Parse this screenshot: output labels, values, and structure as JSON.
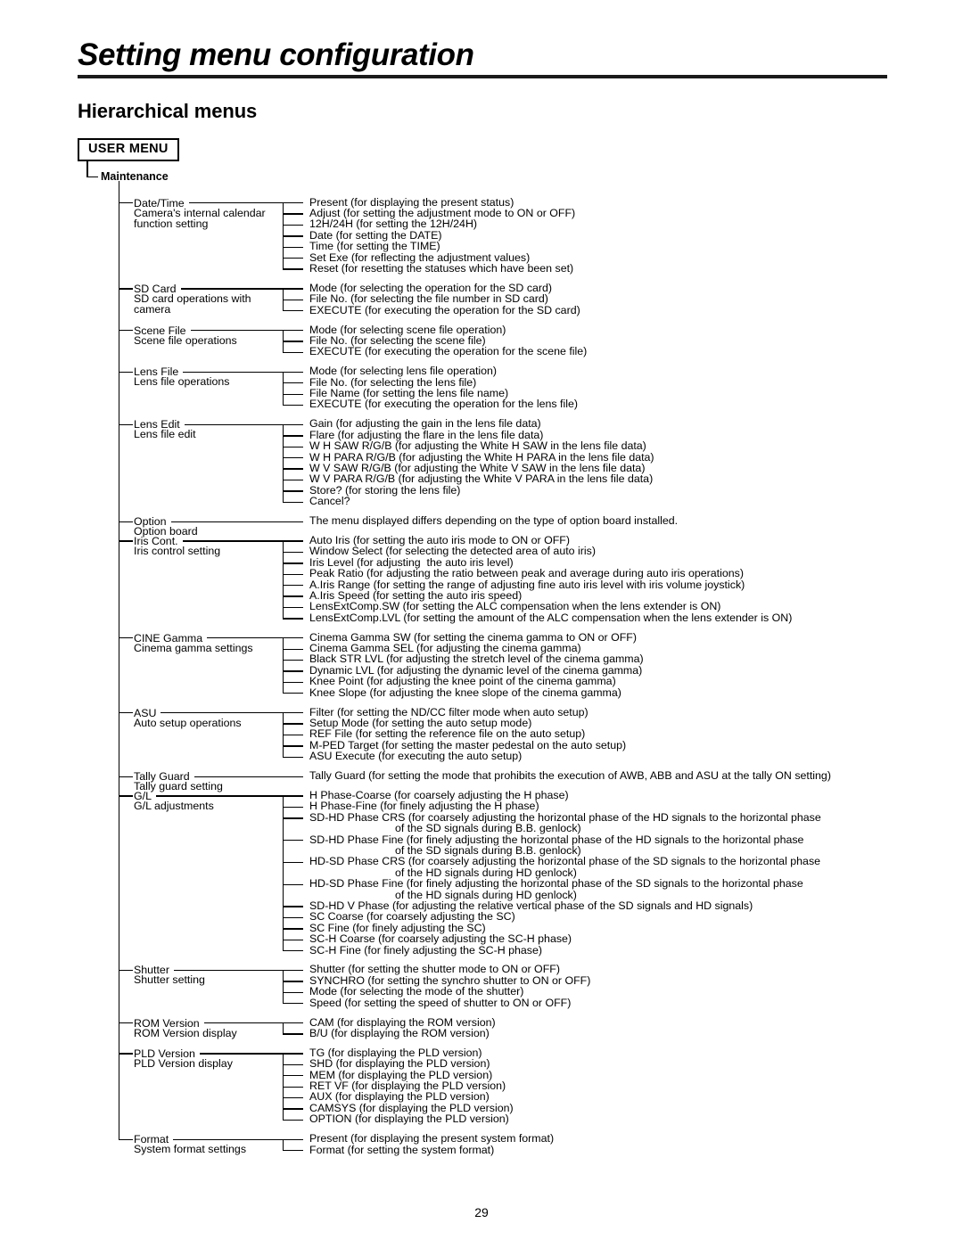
{
  "header": {
    "chapter_title": "Setting menu configuration",
    "section_title": "Hierarchical menus",
    "menu_box_label": "USER MENU",
    "root_node": "Maintenance"
  },
  "page_number": "29",
  "tree": {
    "groups": [
      {
        "name": "Date/Time",
        "desc": "Camera's internal calendar\nfunction setting",
        "rule_end": 318,
        "children": [
          "Present (for displaying the present status)",
          "Adjust (for setting the adjustment mode to ON or OFF)",
          "12H/24H (for setting the 12H/24H)",
          "Date (for setting the DATE)",
          "Time (for setting the TIME)",
          "Set Exe (for reflecting the adjustment values)",
          "Reset (for resetting the statuses which have been set)"
        ]
      },
      {
        "name": "SD Card",
        "desc": "SD card operations with\ncamera",
        "rule_end": 318,
        "children": [
          "Mode (for selecting the operation for the SD card)",
          "File No. (for selecting the file number in SD card)",
          "EXECUTE (for executing the operation for the SD card)"
        ]
      },
      {
        "name": "Scene File",
        "desc": "Scene file operations",
        "rule_end": 318,
        "children": [
          "Mode (for selecting scene file operation)",
          "File No. (for selecting the scene file)",
          "EXECUTE (for executing the operation for the scene file)"
        ]
      },
      {
        "name": "Lens File",
        "desc": "Lens file operations",
        "rule_end": 318,
        "children": [
          "Mode (for selecting lens file operation)",
          "File No. (for selecting the lens file)",
          "File Name (for setting the lens file name)",
          "EXECUTE (for executing the operation for the lens file)"
        ]
      },
      {
        "name": "Lens Edit",
        "desc": "Lens file edit",
        "rule_end": 318,
        "children": [
          "Gain (for adjusting the gain in the lens file data)",
          "Flare (for adjusting the flare in the lens file data)",
          "W H SAW R/G/B (for adjusting the White H SAW in the lens file data)",
          "W H PARA R/G/B (for adjusting the White H PARA in the lens file data)",
          "W V SAW R/G/B (for adjusting the White V SAW in the lens file data)",
          "W V PARA R/G/B (for adjusting the White V PARA in the lens file data)",
          "Store? (for storing the lens file)",
          "Cancel?"
        ]
      },
      {
        "name": "Option",
        "desc": "Option board",
        "rule_end": 340,
        "children": [
          "The menu displayed differs depending on the type of option board installed."
        ]
      },
      {
        "name": "Iris Cont.",
        "desc": "Iris control setting",
        "rule_end": 318,
        "children": [
          "Auto Iris (for setting the auto iris mode to ON or OFF)",
          "Window Select (for selecting the detected area of auto iris)",
          "Iris Level (for adjusting  the auto iris level)",
          "Peak Ratio (for adjusting the ratio between peak and average during auto iris operations)",
          "A.Iris Range (for setting the range of adjusting fine auto iris level with iris volume joystick)",
          "A.Iris Speed (for setting the auto iris speed)",
          "LensExtComp.SW (for setting the ALC compensation when the lens extender is ON)",
          "LensExtComp.LVL (for setting the amount of the ALC compensation when the lens extender is ON)"
        ]
      },
      {
        "name": "CINE Gamma",
        "desc": "Cinema gamma settings",
        "rule_end": 318,
        "children": [
          "Cinema Gamma SW (for setting the cinema gamma to ON or OFF)",
          "Cinema Gamma SEL (for adjusting the cinema gamma)",
          "Black STR LVL (for adjusting the stretch level of the cinema gamma)",
          "Dynamic LVL (for adjusting the dynamic level of the cinema gamma)",
          "Knee Point (for adjusting the knee point of the cinema gamma)",
          "Knee Slope (for adjusting the knee slope of the cinema gamma)"
        ]
      },
      {
        "name": "ASU",
        "desc": "Auto setup operations",
        "rule_end": 318,
        "children": [
          "Filter (for setting the ND/CC filter mode when auto setup)",
          "Setup Mode (for setting the auto setup mode)",
          "REF File (for setting the reference file on the auto setup)",
          "M-PED Target (for setting the master pedestal on the auto setup)",
          "ASU Execute (for executing the auto setup)"
        ]
      },
      {
        "name": "Tally Guard",
        "desc": "Tally guard setting",
        "rule_end": 340,
        "children": [
          "Tally Guard (for setting the mode that prohibits the execution of AWB, ABB and ASU at the tally ON setting)"
        ]
      },
      {
        "name": "G/L",
        "desc": "G/L adjustments",
        "rule_end": 318,
        "children": [
          "H Phase-Coarse (for coarsely adjusting the H phase)",
          "H Phase-Fine (for finely adjusting the H phase)",
          "SD-HD Phase CRS (for coarsely adjusting the horizontal phase of the HD signals to the horizontal phase|of the SD signals during B.B. genlock)",
          "SD-HD Phase Fine (for finely adjusting the horizontal phase of the HD signals to the horizontal phase|of the SD signals during B.B. genlock)",
          "HD-SD Phase CRS (for coarsely adjusting the horizontal phase of the SD signals to the horizontal phase|of the HD signals during HD genlock)",
          "HD-SD Phase Fine (for finely adjusting the horizontal phase of the SD signals to the horizontal phase|of the HD signals during HD genlock)",
          "SD-HD V Phase (for adjusting the relative vertical phase of the SD signals and HD signals)",
          "SC Coarse (for coarsely adjusting the SC)",
          "SC Fine (for finely adjusting the SC)",
          "SC-H Coarse (for coarsely adjusting the SC-H phase)",
          "SC-H Fine (for finely adjusting the SC-H phase)"
        ]
      },
      {
        "name": "Shutter",
        "desc": "Shutter setting",
        "rule_end": 318,
        "children": [
          "Shutter (for setting the shutter mode to ON or OFF)",
          "SYNCHRO (for setting the synchro shutter to ON or OFF)",
          "Mode (for selecting the mode of the shutter)",
          "Speed (for setting the speed of shutter to ON or OFF)"
        ]
      },
      {
        "name": "ROM Version",
        "desc": "ROM Version display",
        "rule_end": 318,
        "children": [
          "CAM (for displaying the ROM version)",
          "B/U (for displaying the ROM version)"
        ]
      },
      {
        "name": "PLD Version",
        "desc": "PLD Version display",
        "rule_end": 318,
        "children": [
          "TG (for displaying the PLD version)",
          "SHD (for displaying the PLD version)",
          "MEM (for displaying the PLD version)",
          "RET VF (for displaying the PLD version)",
          "AUX (for displaying the PLD version)",
          "CAMSYS (for displaying the PLD version)",
          "OPTION (for displaying the PLD version)"
        ]
      },
      {
        "name": "Format",
        "desc": "System format settings",
        "rule_end": 318,
        "children": [
          "Present (for displaying the present system format)",
          "Format (for setting the system format)"
        ]
      }
    ]
  }
}
